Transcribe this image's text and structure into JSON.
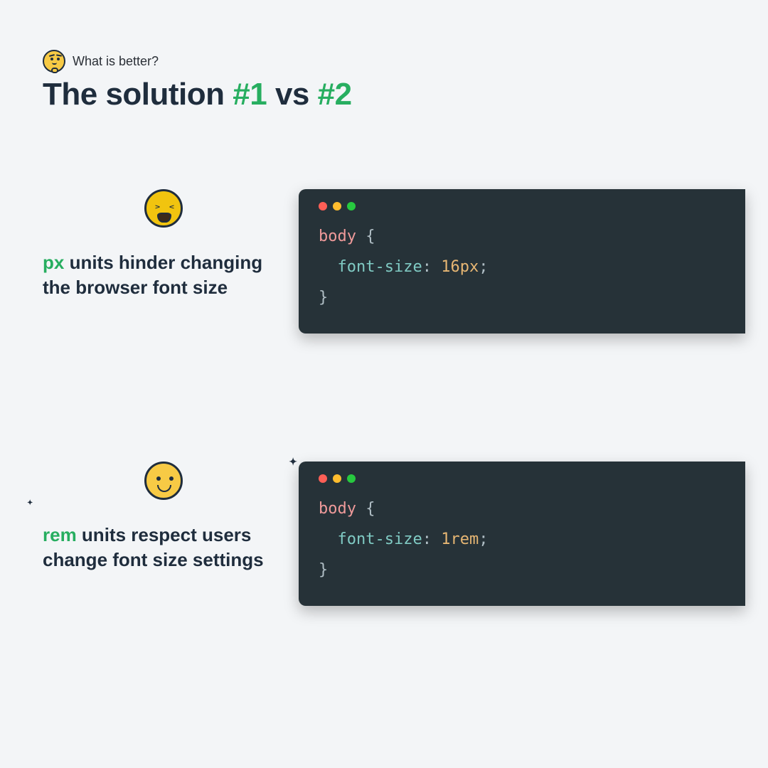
{
  "header": {
    "eyebrow": "What is better?",
    "title_plain_1": "The solution ",
    "title_accent_1": "#1",
    "title_plain_2": "  vs ",
    "title_accent_2": "#2"
  },
  "colors": {
    "accent": "#27ae60",
    "code_bg": "#263238",
    "page_bg": "#f3f5f7"
  },
  "solutions": [
    {
      "emoji_name": "weary-face",
      "caption_accent": "px",
      "caption_rest": " units hinder changing the browser font size",
      "code": {
        "selector": "body",
        "property": "font-size",
        "value": "16px"
      }
    },
    {
      "emoji_name": "happy-face",
      "caption_accent": "rem",
      "caption_rest": " units respect users change font size settings",
      "code": {
        "selector": "body",
        "property": "font-size",
        "value": "1rem"
      }
    }
  ]
}
